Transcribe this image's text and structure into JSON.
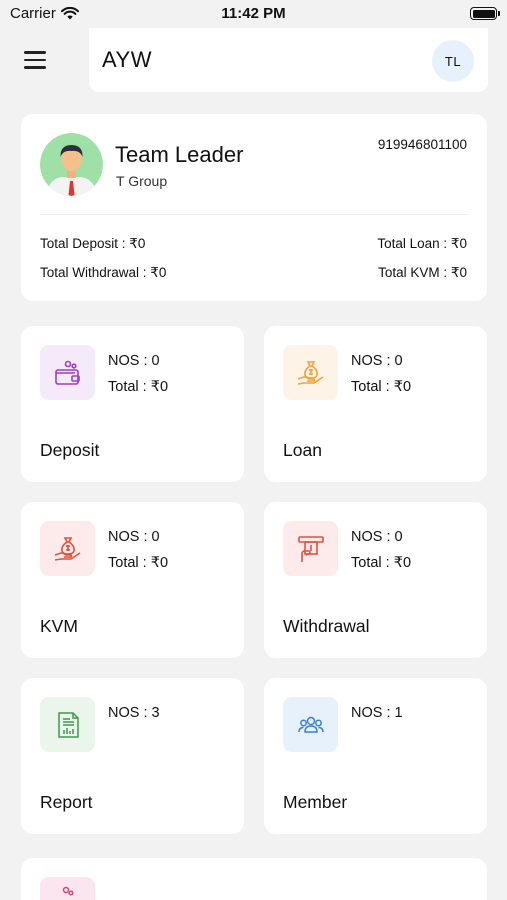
{
  "status_bar": {
    "carrier": "Carrier",
    "time": "11:42 PM"
  },
  "header": {
    "title": "AYW",
    "avatar_initials": "TL"
  },
  "profile": {
    "name": "Team Leader",
    "group": "T Group",
    "phone": "919946801100",
    "total_deposit": "Total Deposit :  ₹0",
    "total_loan": "Total Loan :  ₹0",
    "total_withdrawal": "Total Withdrawal : ₹0",
    "total_kvm": "Total KVM : ₹0"
  },
  "tiles": [
    {
      "title": "Deposit",
      "nos": "NOS : 0",
      "total": "Total : ₹0",
      "icon": "wallet-icon",
      "icon_color": "#9b3fc4",
      "icon_bg": "#f4eafa"
    },
    {
      "title": "Loan",
      "nos": "NOS : 0",
      "total": "Total : ₹0",
      "icon": "money-bag-hand-icon",
      "icon_color": "#f0a43a",
      "icon_bg": "#fdf3e6"
    },
    {
      "title": "KVM",
      "nos": "NOS : 0",
      "total": "Total : ₹0",
      "icon": "money-bag-hand-icon",
      "icon_color": "#e0533d",
      "icon_bg": "#fdeaea"
    },
    {
      "title": "Withdrawal",
      "nos": "NOS : 0",
      "total": "Total : ₹0",
      "icon": "atm-withdraw-icon",
      "icon_color": "#e0533d",
      "icon_bg": "#fdeaea"
    },
    {
      "title": "Report",
      "nos": "NOS : 3",
      "icon": "report-icon",
      "icon_color": "#3f9a4f",
      "icon_bg": "#eaf5ec"
    },
    {
      "title": "Member",
      "nos": "NOS : 1",
      "icon": "group-icon",
      "icon_color": "#3a7fd0",
      "icon_bg": "#e7f1fb"
    }
  ]
}
